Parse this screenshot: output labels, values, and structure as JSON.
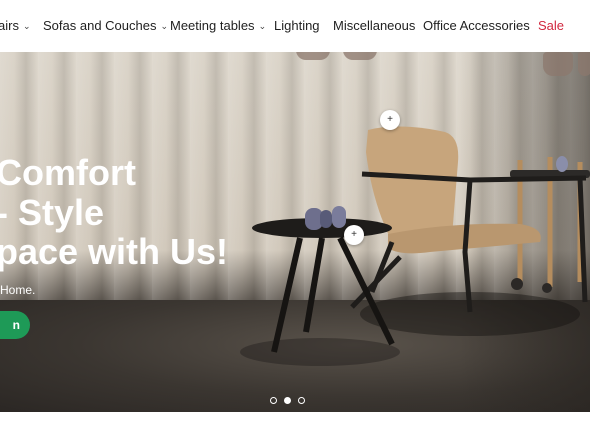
{
  "nav": {
    "items": [
      {
        "label": "airs",
        "chevron": true
      },
      {
        "label": "Sofas and Couches",
        "chevron": true
      },
      {
        "label": "Meeting tables",
        "chevron": true
      },
      {
        "label": "Lighting",
        "chevron": false
      },
      {
        "label": "Miscellaneous",
        "chevron": false
      },
      {
        "label": "Office Accessories",
        "chevron": false
      },
      {
        "label": "Sale",
        "chevron": false
      }
    ]
  },
  "hero": {
    "title_lines": [
      "Comfort",
      "- Style",
      "pace with Us!"
    ],
    "subtitle": "Home.",
    "cta_label": "n",
    "hotspot_symbol": "+",
    "slides": {
      "count": 3,
      "active": 2
    }
  },
  "colors": {
    "sale": "#d1283f",
    "cta": "#1e9a57"
  }
}
